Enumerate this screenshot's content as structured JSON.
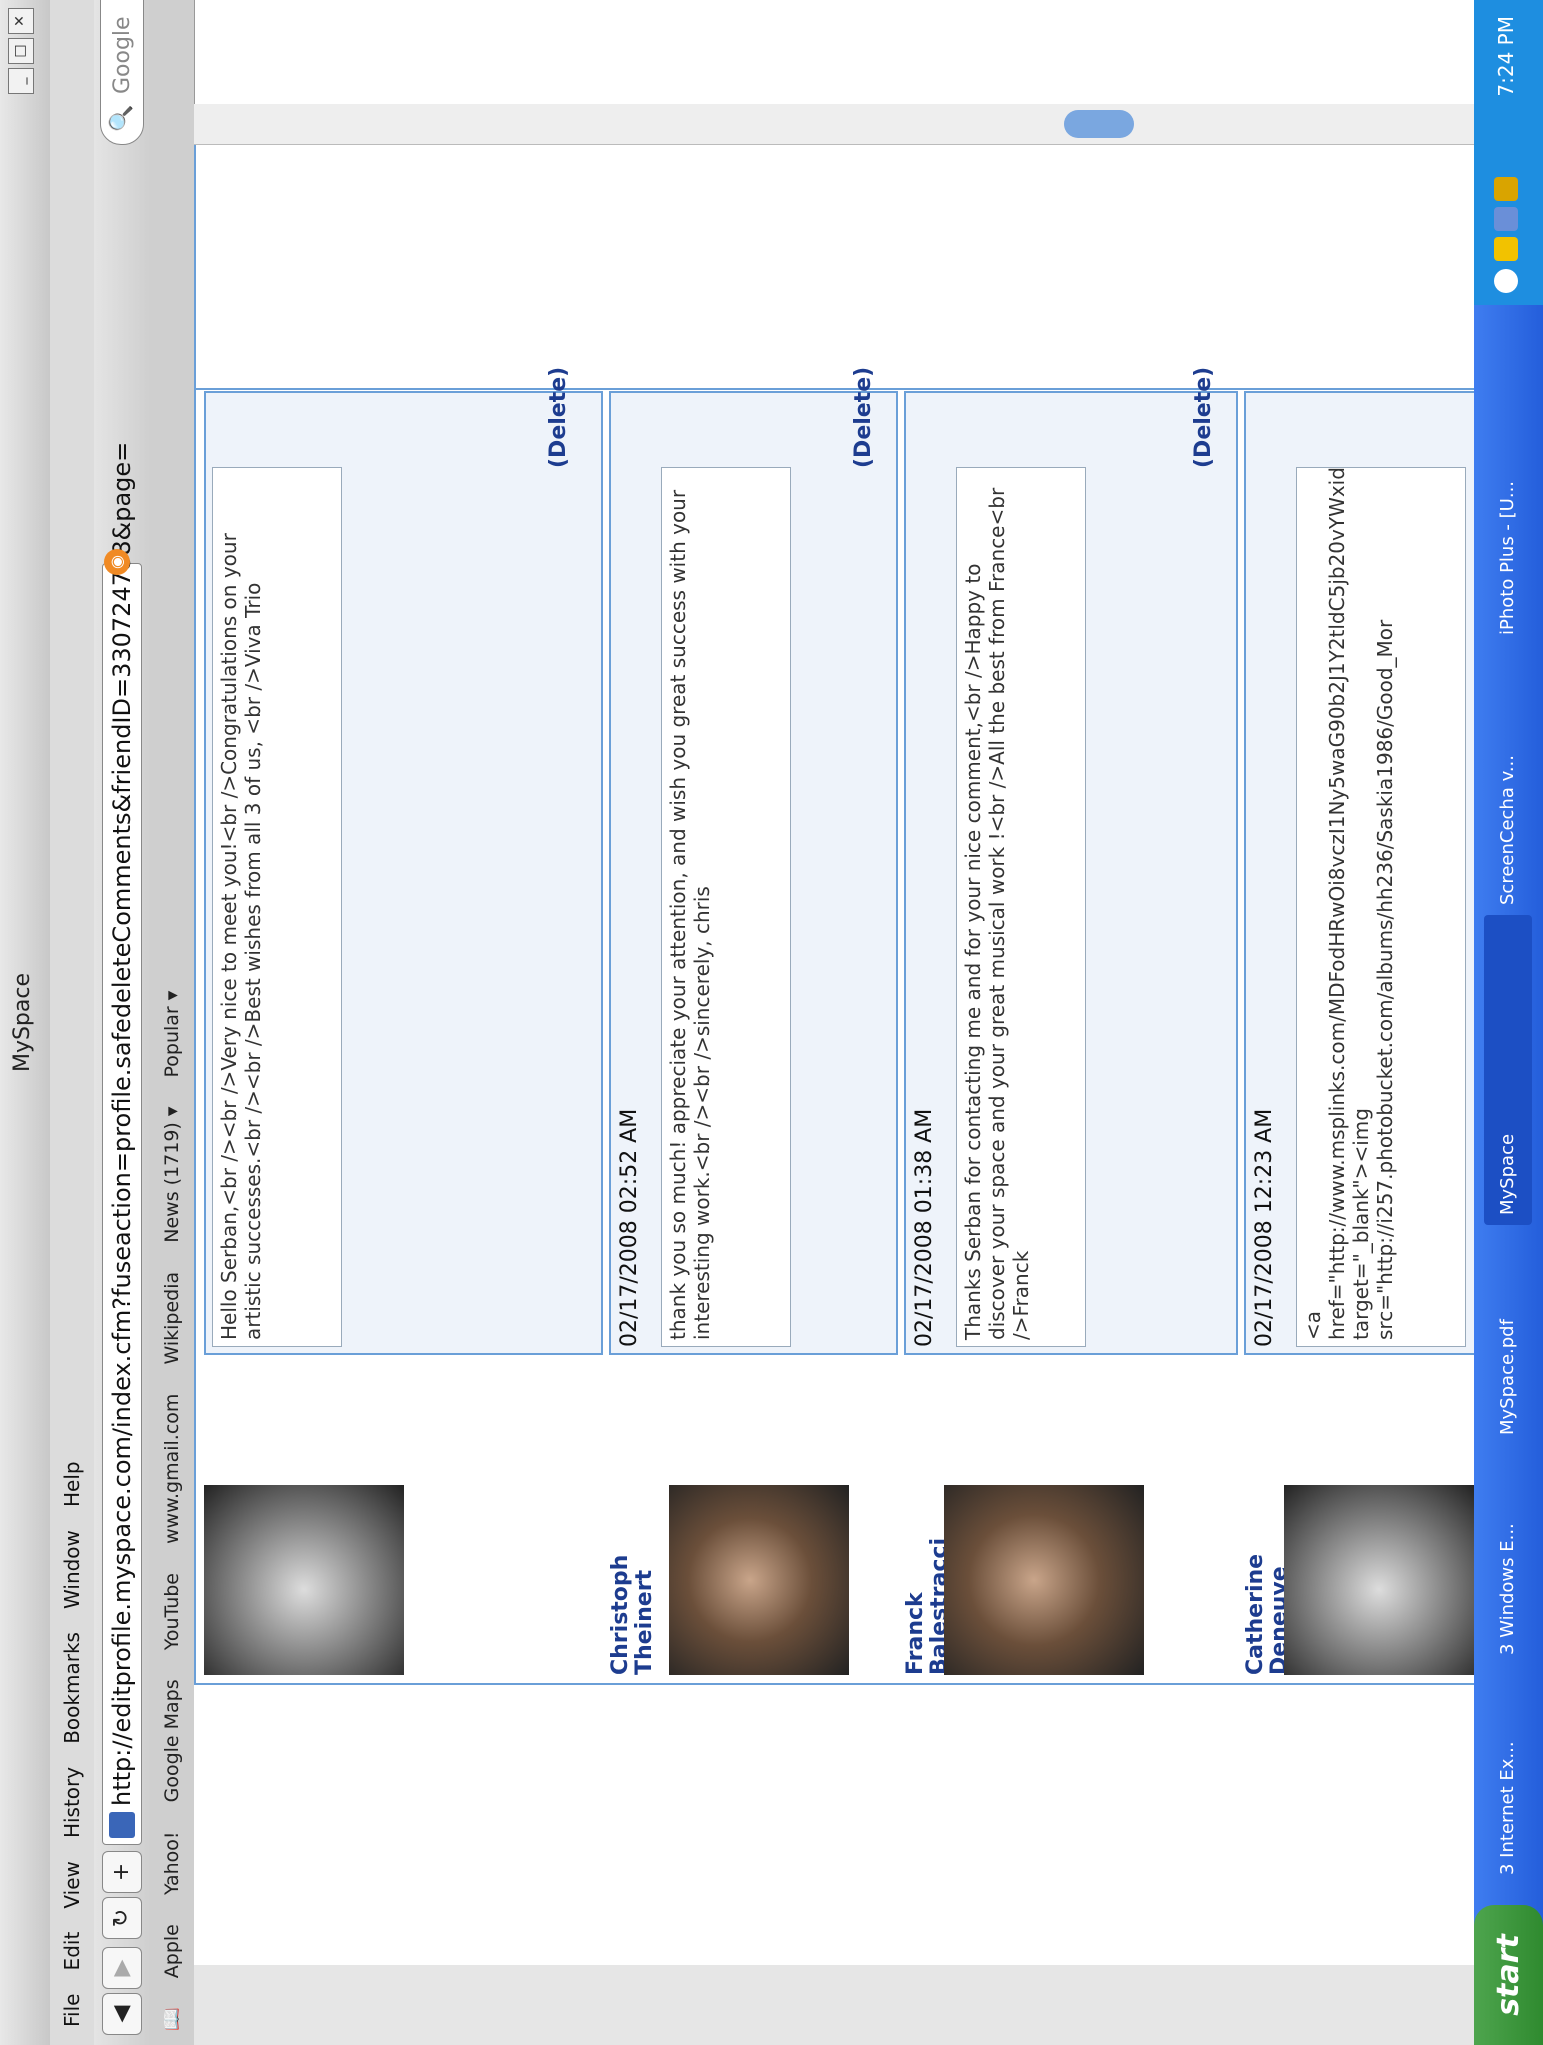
{
  "window": {
    "title": "MySpace"
  },
  "menu": [
    "File",
    "Edit",
    "View",
    "History",
    "Bookmarks",
    "Window",
    "Help"
  ],
  "toolbar": {
    "url": "http://editprofile.myspace.com/index.cfm?fuseaction=profile.safedeleteComments&friendID=330724788&page=",
    "search_placeholder": "Google"
  },
  "bookmarks": [
    "Apple",
    "Yahoo!",
    "Google Maps",
    "YouTube",
    "www.gmail.com",
    "Wikipedia",
    "News (1719) ▾",
    "Popular ▾"
  ],
  "comments": [
    {
      "name": "",
      "date": "",
      "text": "Hello Serban,<br /><br />Very nice to meet you!<br />Congratulations on your artistic successes.<br /><br />Best wishes from all 3 of us, <br />Viva Trio",
      "delete": "(Delete)"
    },
    {
      "name": "Christoph Theinert",
      "date": "02/17/2008 02:52 AM",
      "text": "thank you so much! appreciate your attention, and wish you great success with your interesting work.<br /><br />sincerely, chris",
      "delete": "(Delete)"
    },
    {
      "name": "Franck Balestracci",
      "date": "02/17/2008 01:38 AM",
      "text": "Thanks Serban for contacting me and for your nice comment,<br />Happy to discover your space and your great musical work !<br />All the best from France<br />Franck",
      "delete": "(Delete)"
    },
    {
      "name": "Catherine Deneuve",
      "date": "02/17/2008 12:23 AM",
      "text": "<a href=\"http://www.msplinks.com/MDFodHRwOi8vczI1Ny5waG90b2J1Y2tldC5jb20vYWxidW1zL2hoMjM2L1Nhc2tpYTE5ODYvP2FjdGlvbj12aWV3JmN1cnJlbnQ9R29vZF9Nb3JuaW5nLmdpZg==\" target=\"_blank\"><img src=\"http://i257.photobucket.com/albums/hh236/Saskia1986/Good_Mor",
      "delete": ""
    }
  ],
  "taskbar": {
    "start": "start",
    "tasks": [
      "3 Internet Ex...",
      "3 Windows E...",
      "MySpace.pdf",
      "MySpace",
      "ScreenCecha v...",
      "iPhoto Plus - [U..."
    ],
    "clock": "7:24 PM"
  },
  "colors": {
    "link": "#1d3c8f",
    "border": "#6a9fd8",
    "taskbar": "#245edb"
  }
}
